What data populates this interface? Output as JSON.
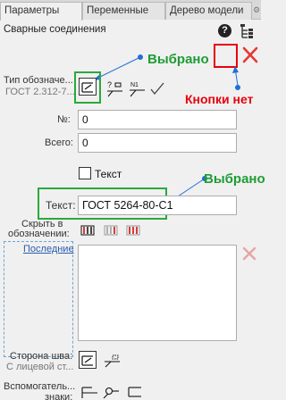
{
  "tabs": [
    {
      "label": "Параметры",
      "active": true
    },
    {
      "label": "Переменные",
      "active": false
    },
    {
      "label": "Дерево модели",
      "active": false
    }
  ],
  "panel_title": "Сварные соединения",
  "type_designation": {
    "label": "Тип обозначе...",
    "sublabel": "ГОСТ 2.312-7..."
  },
  "number_field": {
    "label": "№:",
    "value": "0"
  },
  "total_field": {
    "label": "Всего:",
    "value": "0"
  },
  "text_checkbox": {
    "label": "Текст",
    "checked": false
  },
  "text_field": {
    "label": "Текст:",
    "value": "ГОСТ 5264-80-С1"
  },
  "hide_in_designation": {
    "label_line1": "Скрыть в",
    "label_line2": "обозначении:"
  },
  "last_link": "Последние",
  "seam_side": {
    "label_line1": "Сторона шва:",
    "label_line2": "С лицевой ст..."
  },
  "aux_signs": {
    "label_line1": "Вспомогатель...",
    "label_line2": "знаки:"
  },
  "annotations": {
    "selected_top": "Выбрано",
    "no_buttons": "Кнопки нет",
    "selected_text": "Выбрано"
  },
  "colors": {
    "annotation_green": "#1f9c35",
    "annotation_red": "#e8000b",
    "annotation_marker": "#1f6fd6",
    "close_red": "#e53935"
  }
}
